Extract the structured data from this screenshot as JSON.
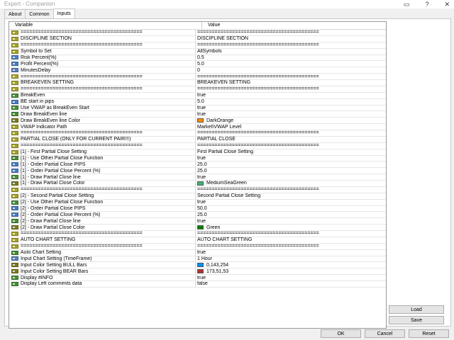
{
  "window": {
    "title": "Expert - Companion"
  },
  "tabs": [
    "About",
    "Common",
    "Inputs"
  ],
  "active_tab": "Inputs",
  "table": {
    "headers": [
      "Variable",
      "Value"
    ],
    "rows": [
      {
        "t": "str",
        "v": "==========================================",
        "val": "=========================================="
      },
      {
        "t": "str",
        "v": "DISCIPLINE SECTION",
        "val": "DISCIPLINE SECTION"
      },
      {
        "t": "str",
        "v": "==========================================",
        "val": "=========================================="
      },
      {
        "t": "str",
        "v": "Symbol to Set",
        "val": "AllSymbols"
      },
      {
        "t": "dbl",
        "v": "Risk Percent(%)",
        "val": "0.5"
      },
      {
        "t": "dbl",
        "v": "Profit Percent(%)",
        "val": "5.0"
      },
      {
        "t": "int",
        "v": "MinutesDelay",
        "val": "0"
      },
      {
        "t": "str",
        "v": "==========================================",
        "val": "=========================================="
      },
      {
        "t": "str",
        "v": "BREAKEVEN SETTING",
        "val": "BREAKEVEN SETTING"
      },
      {
        "t": "str",
        "v": "==========================================",
        "val": "=========================================="
      },
      {
        "t": "bool",
        "v": "BreakEven",
        "val": "true"
      },
      {
        "t": "dbl",
        "v": "BE start in pips",
        "val": "5.0"
      },
      {
        "t": "bool",
        "v": "Use VWAP as BreakEven Start",
        "val": "true"
      },
      {
        "t": "bool",
        "v": "Draw BreakEven line",
        "val": "true"
      },
      {
        "t": "clr",
        "v": "Draw BreakEven line Color",
        "val": "DarkOrange",
        "color": "#ff8c00"
      },
      {
        "t": "str",
        "v": "VWAP Indicator Path",
        "val": "Market\\VWAP Level"
      },
      {
        "t": "str",
        "v": "==========================================",
        "val": "=========================================="
      },
      {
        "t": "str",
        "v": "PARTIAL CLOSE (ONLY FOR CURRENT PAIR!!!)",
        "val": "PARTIAL CLOSE"
      },
      {
        "t": "str",
        "v": "==========================================",
        "val": "=========================================="
      },
      {
        "t": "str",
        "v": "[1] - First Partial Close Setting",
        "val": "First Partial Close Setting"
      },
      {
        "t": "bool",
        "v": "[1] - Use Other Partial Close Function",
        "val": "true"
      },
      {
        "t": "dbl",
        "v": "[1] - Order Partial Close PIPS",
        "val": "25.0"
      },
      {
        "t": "dbl",
        "v": "[1] - Order Partial Close Percent (%)",
        "val": "25.0"
      },
      {
        "t": "bool",
        "v": "[1] - Draw Partial Close line",
        "val": "true"
      },
      {
        "t": "clr",
        "v": "[1] - Draw Partial Close Color",
        "val": "MediumSeaGreen",
        "color": "#3cb371"
      },
      {
        "t": "str",
        "v": "==========================================",
        "val": "=========================================="
      },
      {
        "t": "str",
        "v": "[2] - Second Partial Close Setting",
        "val": "Second Partial Close Setting"
      },
      {
        "t": "bool",
        "v": "[2] - Use Other Partial Close Function",
        "val": "true"
      },
      {
        "t": "dbl",
        "v": "[2] - Order Partial Close PIPS",
        "val": "50.0"
      },
      {
        "t": "dbl",
        "v": "[2] - Order Partial Close Percent (%)",
        "val": "25.0"
      },
      {
        "t": "bool",
        "v": "[2] - Draw Partial Close line",
        "val": "true"
      },
      {
        "t": "clr",
        "v": "[2] - Draw Partial Close Color",
        "val": "Green",
        "color": "#008000"
      },
      {
        "t": "str",
        "v": "==========================================",
        "val": "=========================================="
      },
      {
        "t": "str",
        "v": "AUTO CHART SETTING",
        "val": "AUTO CHART SETTING"
      },
      {
        "t": "str",
        "v": "==========================================",
        "val": "=========================================="
      },
      {
        "t": "bool",
        "v": "Auto Chart Setting",
        "val": "true"
      },
      {
        "t": "int",
        "v": "Input Chart Setting (TimeFrame)",
        "val": "1 Hour"
      },
      {
        "t": "clr",
        "v": "Input Color Setting BULL Bars",
        "val": "0,143,254",
        "color": "#008ffe"
      },
      {
        "t": "clr",
        "v": "Input Color Setting BEAR Bars",
        "val": "173,51,53",
        "color": "#ad3335"
      },
      {
        "t": "bool",
        "v": "Display #INFO",
        "val": "true"
      },
      {
        "t": "bool",
        "v": "Display Left comments data",
        "val": "false"
      }
    ]
  },
  "buttons": {
    "load": "Load",
    "save": "Save",
    "ok": "OK",
    "cancel": "Cancel",
    "reset": "Reset"
  }
}
